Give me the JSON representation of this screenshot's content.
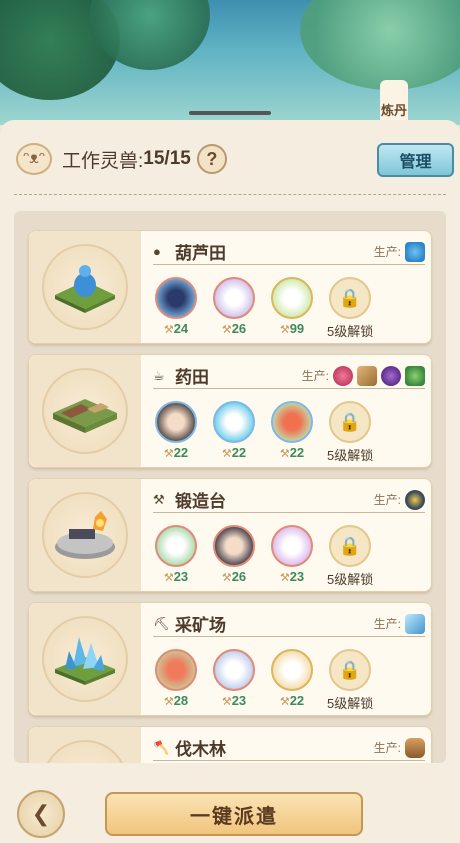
{
  "top_tab": {
    "label": "炼丹"
  },
  "header": {
    "label": "工作灵兽:",
    "count": "15/15",
    "help": "?",
    "manage": "管理"
  },
  "colors": {
    "accent": "#7fc6d8",
    "level_green": "#3c8a5e",
    "dispatch": "#f0c57e"
  },
  "prod_label": "生产:",
  "lock_text": "5级解锁",
  "buildings": [
    {
      "name": "葫芦田",
      "icon": "gourd-icon",
      "products": [
        "potion-icon"
      ],
      "workers": [
        {
          "level": "24"
        },
        {
          "level": "26"
        },
        {
          "level": "99"
        }
      ]
    },
    {
      "name": "药田",
      "icon": "watering-can-icon",
      "products": [
        "raspberry-icon",
        "herb-bundle-icon",
        "grape-icon",
        "leaf-icon"
      ],
      "workers": [
        {
          "level": "22"
        },
        {
          "level": "22"
        },
        {
          "level": "22"
        }
      ]
    },
    {
      "name": "锻造台",
      "icon": "anvil-icon",
      "products": [
        "ore-icon"
      ],
      "workers": [
        {
          "level": "23"
        },
        {
          "level": "26"
        },
        {
          "level": "23"
        }
      ]
    },
    {
      "name": "采矿场",
      "icon": "pickaxe-icon",
      "products": [
        "crystal-icon"
      ],
      "workers": [
        {
          "level": "28"
        },
        {
          "level": "23"
        },
        {
          "level": "22"
        }
      ]
    },
    {
      "name": "伐木林",
      "icon": "axe-icon",
      "products": [
        "wood-icon"
      ],
      "workers": []
    }
  ],
  "dispatch": {
    "label": "一键派遣"
  }
}
